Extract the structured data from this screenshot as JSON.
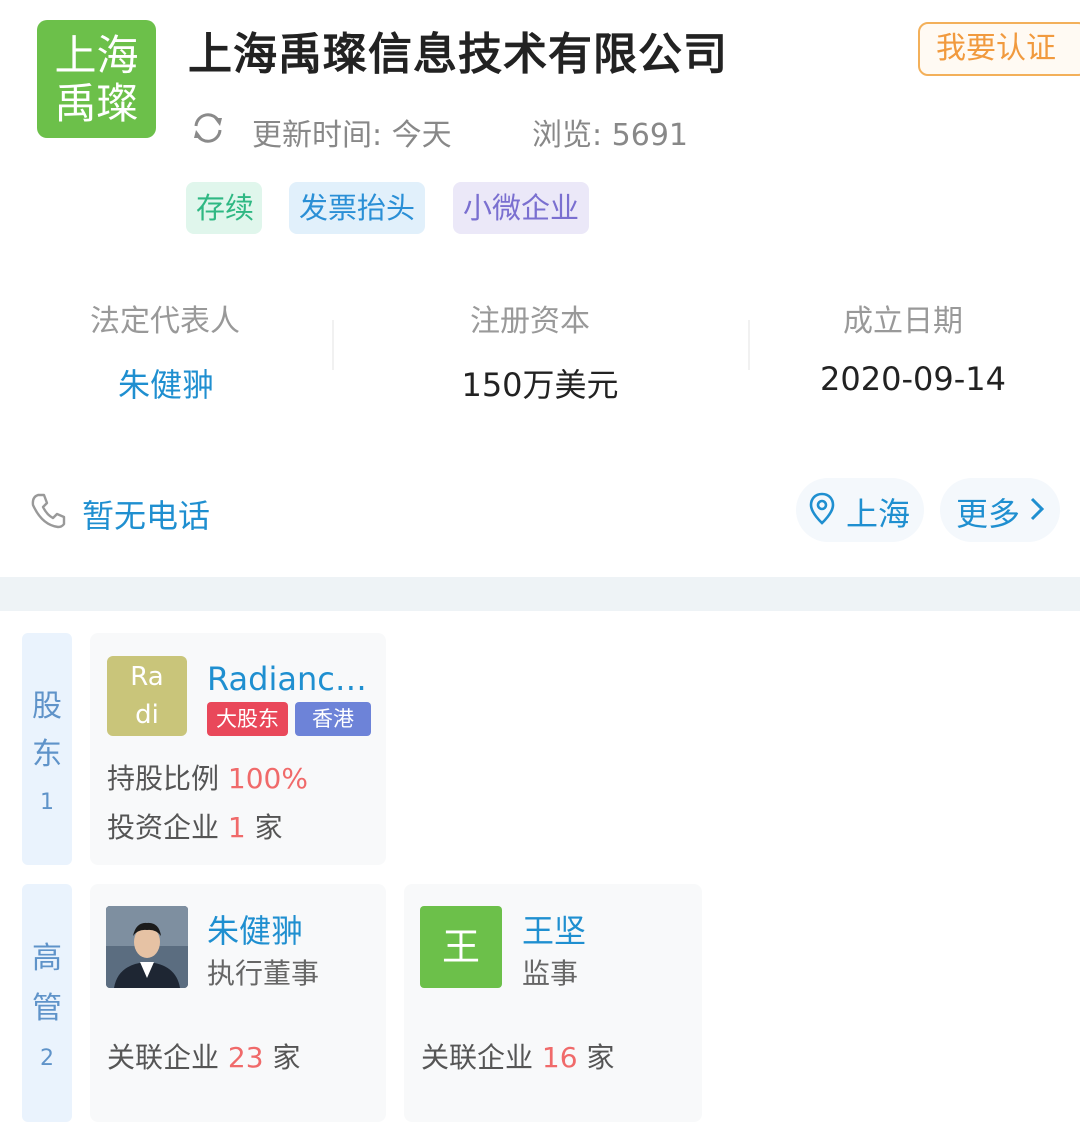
{
  "company": {
    "logo_line1": "上海",
    "logo_line2": "禹璨",
    "name": "上海禹璨信息技术有限公司",
    "certify_button": "我要认证",
    "update_time": "更新时间: 今天",
    "views": "浏览: 5691",
    "tags": [
      "存续",
      "发票抬头",
      "小微企业"
    ]
  },
  "info": {
    "legal_rep_label": "法定代表人",
    "legal_rep_value": "朱健翀",
    "capital_label": "注册资本",
    "capital_value": "150万美元",
    "founded_label": "成立日期",
    "founded_value": "2020-09-14"
  },
  "contact": {
    "phone_text": "暂无电话",
    "location_text": "上海",
    "more_text": "更多"
  },
  "shareholders": {
    "side_label_1": "股",
    "side_label_2": "东",
    "count": "1",
    "items": [
      {
        "avatar_line1": "Ra",
        "avatar_line2": "di",
        "name": "Radianc…",
        "badges": [
          "大股东",
          "香港"
        ],
        "ratio_label": "持股比例",
        "ratio_value": "100%",
        "invest_label": "投资企业",
        "invest_count": "1",
        "invest_unit": "家"
      }
    ]
  },
  "executives": {
    "side_label_1": "高",
    "side_label_2": "管",
    "count": "2",
    "items": [
      {
        "name": "朱健翀",
        "role": "执行董事",
        "related_label": "关联企业",
        "related_count": "23",
        "related_unit": "家"
      },
      {
        "avatar_text": "王",
        "name": "王坚",
        "role": "监事",
        "related_label": "关联企业",
        "related_count": "16",
        "related_unit": "家"
      }
    ]
  },
  "colors": {
    "brand_green": "#6cc04a",
    "link_blue": "#1f8fd0",
    "accent_orange": "#f19a3e",
    "highlight_red": "#f06a6a"
  }
}
